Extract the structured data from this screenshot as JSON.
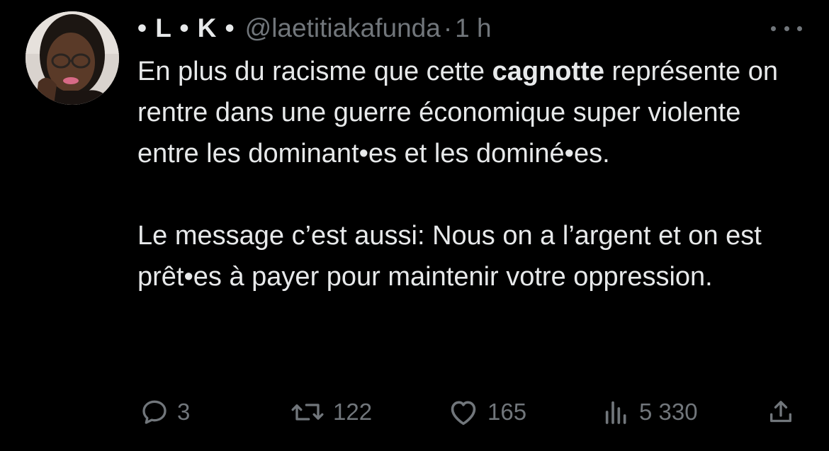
{
  "tweet": {
    "display_name": "• L • K •",
    "handle": "@laetitiakafunda",
    "separator": "·",
    "time": "1 h",
    "body": {
      "p1_before": "En plus du racisme que cette ",
      "p1_bold": "cagnotte",
      "p1_after": " représente on rentre dans une guerre économique super violente entre les dominant•es et les dominé•es.",
      "p2": "Le message c’est aussi: Nous on a l’argent et on est prêt•es à payer pour maintenir votre oppression."
    },
    "actions": {
      "replies": "3",
      "retweets": "122",
      "likes": "165",
      "views": "5 330"
    },
    "icons": {
      "avatar": "avatar",
      "more": "more-dots-icon",
      "reply": "reply-icon",
      "retweet": "retweet-icon",
      "like": "heart-icon",
      "views": "views-chart-icon",
      "share": "share-icon"
    },
    "colors": {
      "background": "#000000",
      "text": "#e7e9ea",
      "muted": "#71767b"
    }
  }
}
